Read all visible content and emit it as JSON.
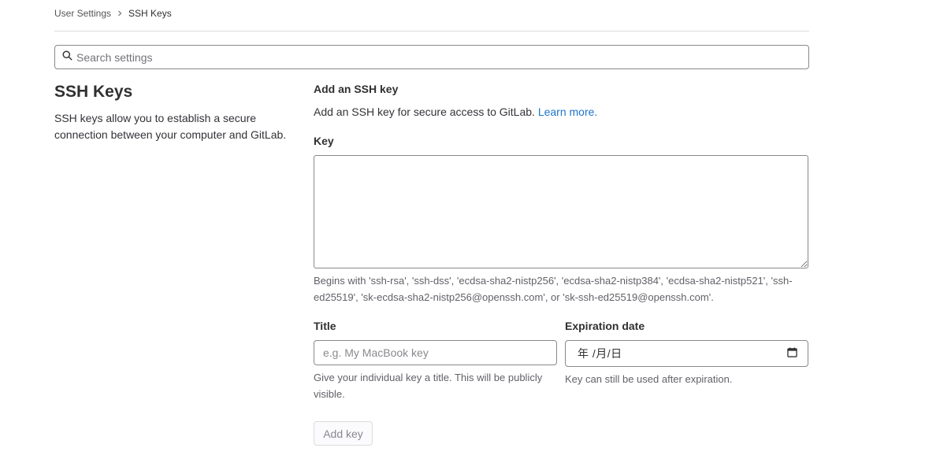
{
  "breadcrumb": {
    "parent": "User Settings",
    "current": "SSH Keys"
  },
  "search": {
    "placeholder": "Search settings"
  },
  "sidebar": {
    "title": "SSH Keys",
    "description": "SSH keys allow you to establish a secure connection between your computer and GitLab."
  },
  "form": {
    "heading": "Add an SSH key",
    "intro": "Add an SSH key for secure access to GitLab.",
    "learn_more": "Learn more.",
    "key_label": "Key",
    "key_value": "",
    "key_help": "Begins with 'ssh-rsa', 'ssh-dss', 'ecdsa-sha2-nistp256', 'ecdsa-sha2-nistp384', 'ecdsa-sha2-nistp521', 'ssh-ed25519', 'sk-ecdsa-sha2-nistp256@openssh.com', or 'sk-ssh-ed25519@openssh.com'.",
    "title_label": "Title",
    "title_placeholder": "e.g. My MacBook key",
    "title_help": "Give your individual key a title. This will be publicly visible.",
    "expiration_label": "Expiration date",
    "expiration_display": "年 /月/日",
    "expiration_help": "Key can still be used after expiration.",
    "submit_label": "Add key"
  },
  "icons": {
    "breadcrumb_separator": "chevron-right-icon",
    "search": "search-icon",
    "calendar": "calendar-icon"
  },
  "colors": {
    "link": "#1f75cb",
    "border": "#89888d",
    "divider": "#dcdcde"
  }
}
